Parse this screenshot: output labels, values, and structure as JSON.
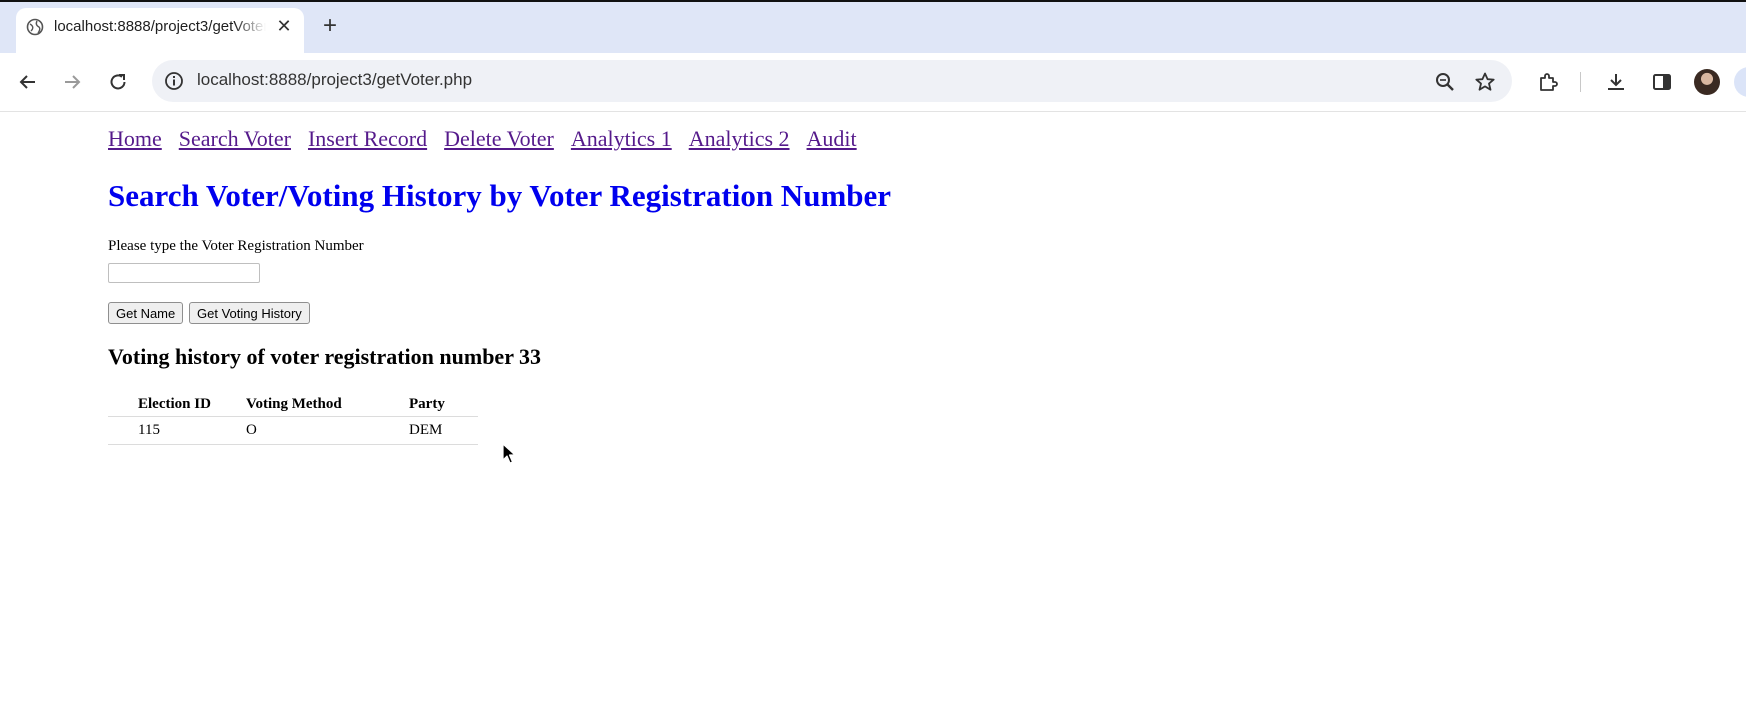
{
  "browser": {
    "tab_title": "localhost:8888/project3/getVoter.php",
    "close_glyph": "✕",
    "new_tab_glyph": "+",
    "url": "localhost:8888/project3/getVoter.php",
    "icons": [
      "globe-icon",
      "back-arrow-icon",
      "forward-arrow-icon",
      "reload-icon",
      "info-icon",
      "zoom-icon",
      "bookmark-star-icon",
      "extensions-icon",
      "download-icon",
      "side-panel-icon",
      "profile-avatar"
    ]
  },
  "nav": {
    "links": [
      "Home",
      "Search Voter",
      "Insert Record",
      "Delete Voter",
      "Analytics 1",
      "Analytics 2",
      "Audit"
    ]
  },
  "main": {
    "title": "Search Voter/Voting History by Voter Registration Number",
    "prompt": "Please type the Voter Registration Number",
    "input_value": "",
    "buttons": {
      "get_name": "Get Name",
      "get_history": "Get Voting History"
    },
    "history_title": "Voting history of voter registration number 33",
    "table": {
      "headers": [
        "Election ID",
        "Voting Method",
        "Party"
      ],
      "rows": [
        [
          "115",
          "O",
          "DEM"
        ]
      ]
    }
  },
  "colors": {
    "link_visited": "#551a8b",
    "title_blue": "#0000ee",
    "chrome_bg": "#dfe6f7"
  }
}
